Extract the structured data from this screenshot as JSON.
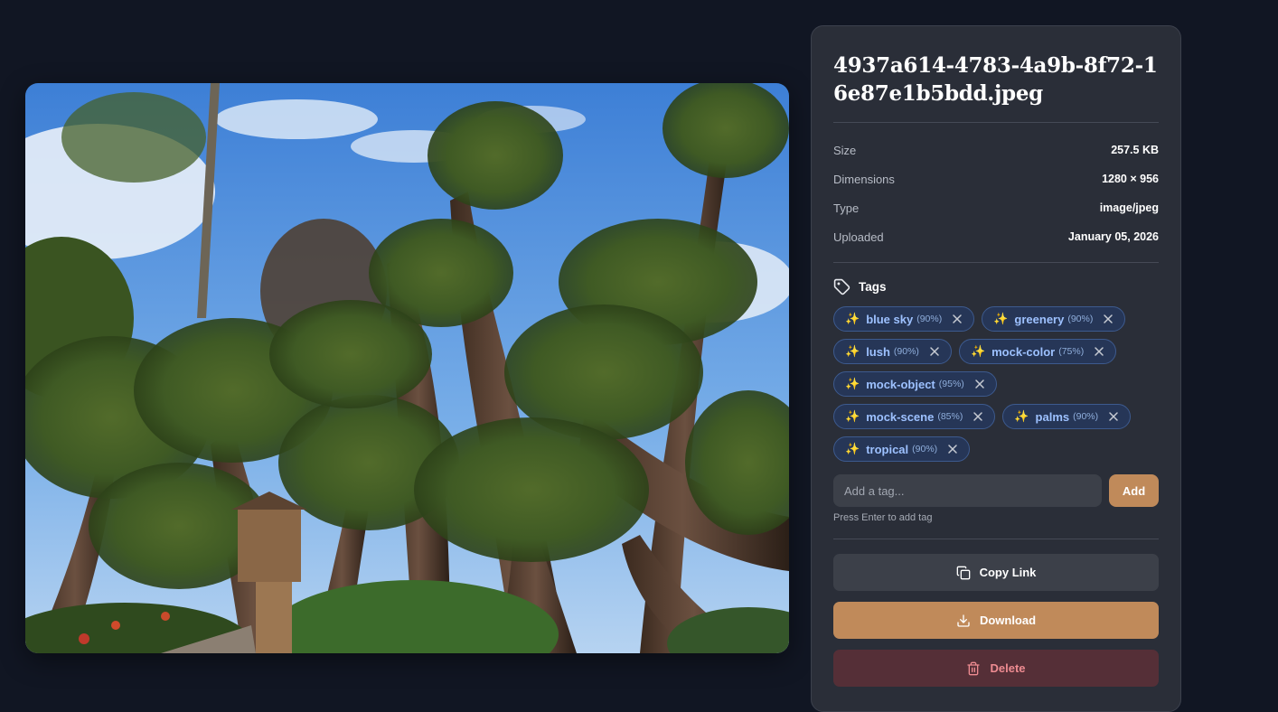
{
  "file": {
    "name": "4937a614-4783-4a9b-8f72-16e87e1b5bdd.jpeg"
  },
  "meta": [
    {
      "label": "Size",
      "value": "257.5 KB"
    },
    {
      "label": "Dimensions",
      "value": "1280 × 956"
    },
    {
      "label": "Type",
      "value": "image/jpeg"
    },
    {
      "label": "Uploaded",
      "value": "January 05, 2026"
    }
  ],
  "tags": {
    "heading": "Tags",
    "items": [
      {
        "name": "blue sky",
        "confidence": "(90%)"
      },
      {
        "name": "greenery",
        "confidence": "(90%)"
      },
      {
        "name": "lush",
        "confidence": "(90%)"
      },
      {
        "name": "mock-color",
        "confidence": "(75%)"
      },
      {
        "name": "mock-object",
        "confidence": "(95%)"
      },
      {
        "name": "mock-scene",
        "confidence": "(85%)"
      },
      {
        "name": "palms",
        "confidence": "(90%)"
      },
      {
        "name": "tropical",
        "confidence": "(90%)"
      }
    ],
    "input_value": "",
    "input_placeholder": "Add a tag...",
    "add_label": "Add",
    "hint": "Press Enter to add tag"
  },
  "actions": {
    "copy_label": "Copy Link",
    "download_label": "Download",
    "delete_label": "Delete"
  },
  "icons": {
    "tag": "tag-icon",
    "sparkle": "sparkles-icon",
    "remove": "close-icon",
    "copy": "copy-icon",
    "download": "download-icon",
    "delete": "trash-icon"
  },
  "colors": {
    "background": "#111623",
    "panel": "#2a2e38",
    "accent": "#c08a5a",
    "tag_bg": "#263657",
    "tag_text": "#9dc1ff",
    "danger_bg": "#552f37",
    "danger_text": "#ee8b91"
  }
}
